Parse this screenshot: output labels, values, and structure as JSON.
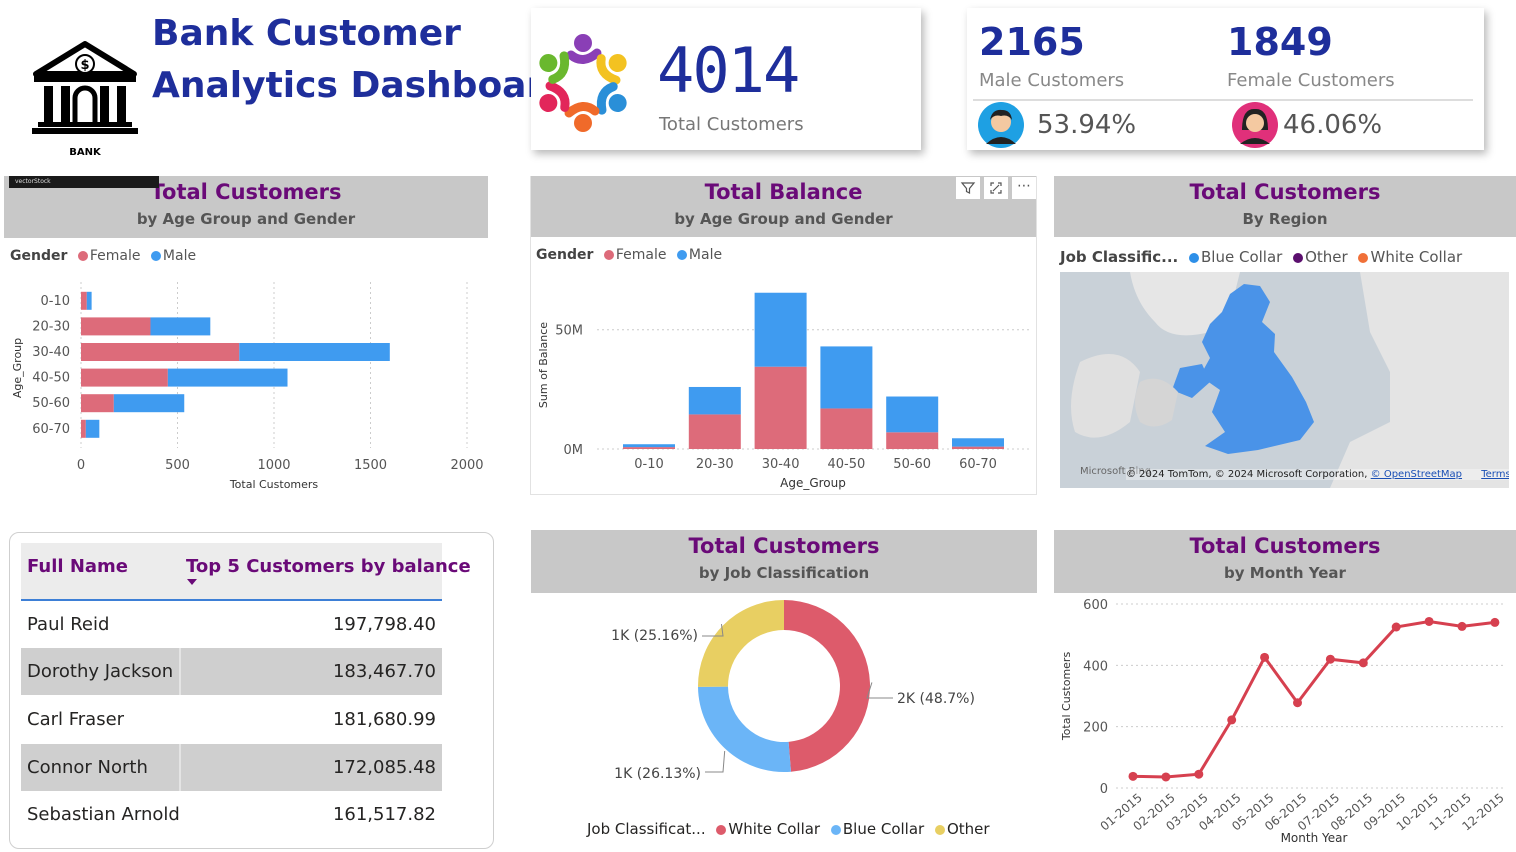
{
  "header": {
    "title_line1": "Bank Customer",
    "title_line2": "Analytics Dashboard",
    "logo_label": "BANK"
  },
  "kpi_total": {
    "value": "4014",
    "label": "Total Customers"
  },
  "kpi_gender": {
    "male_value": "2165",
    "male_label": "Male Customers",
    "male_pct": "53.94%",
    "female_value": "1849",
    "female_label": "Female Customers",
    "female_pct": "46.06%"
  },
  "panels": {
    "age_gender_customers": {
      "title": "Total Customers",
      "subtitle": "by Age Group and Gender",
      "stock_label": "vectorStock"
    },
    "age_gender_balance": {
      "title": "Total Balance",
      "subtitle": "by Age Group and Gender"
    },
    "region": {
      "title": "Total Customers",
      "subtitle": "By Region"
    },
    "job": {
      "title": "Total Customers",
      "subtitle": "by Job Classification"
    },
    "month": {
      "title": "Total Customers",
      "subtitle": "by Month Year"
    }
  },
  "legends": {
    "gender_title": "Gender",
    "female": "Female",
    "male": "Male",
    "job_title_region": "Job Classific...",
    "job_title_donut": "Job Classificat...",
    "blue_collar": "Blue Collar",
    "other": "Other",
    "white_collar": "White Collar"
  },
  "map": {
    "attribution": "© 2024 TomTom, © 2024 Microsoft Corporation,",
    "osm_link": "© OpenStreetMap",
    "terms_link": "Terms",
    "brand": "Microsoft Bing"
  },
  "table": {
    "col_name": "Full Name",
    "col_balance": "Top 5 Customers by balance",
    "rows": [
      {
        "name": "Paul Reid",
        "balance": "197,798.40"
      },
      {
        "name": "Dorothy Jackson",
        "balance": "183,467.70"
      },
      {
        "name": "Carl Fraser",
        "balance": "181,680.99"
      },
      {
        "name": "Connor North",
        "balance": "172,085.48"
      },
      {
        "name": "Sebastian Arnold",
        "balance": "161,517.82"
      }
    ]
  },
  "colors": {
    "female": "#dd6b7a",
    "male": "#3f9bf0",
    "white_collar": "#dd5b6b",
    "blue_collar": "#6bb5f7",
    "other": "#e8cf62",
    "line": "#d6404f",
    "title_blue": "#1e2e9b",
    "purple": "#6a0a78"
  },
  "chart_data": [
    {
      "type": "bar",
      "orientation": "horizontal",
      "stacked": true,
      "categories": [
        "0-10",
        "20-30",
        "30-40",
        "40-50",
        "50-60",
        "60-70"
      ],
      "series": [
        {
          "name": "Female",
          "values": [
            30,
            360,
            820,
            450,
            170,
            25
          ]
        },
        {
          "name": "Male",
          "values": [
            25,
            310,
            780,
            620,
            365,
            70
          ]
        }
      ],
      "xlabel": "Total Customers",
      "ylabel": "Age_Group",
      "xticks": [
        "0",
        "500",
        "1000",
        "1500",
        "2000"
      ],
      "xlim": [
        0,
        2000
      ]
    },
    {
      "type": "bar",
      "stacked": true,
      "categories": [
        "0-10",
        "20-30",
        "30-40",
        "40-50",
        "50-60",
        "60-70"
      ],
      "series": [
        {
          "name": "Female",
          "values": [
            0.8,
            14.5,
            34.5,
            17,
            7,
            1
          ]
        },
        {
          "name": "Male",
          "values": [
            1.2,
            11.5,
            31,
            26,
            15,
            3.5
          ]
        }
      ],
      "xlabel": "Age_Group",
      "ylabel": "Sum of Balance",
      "yticks": [
        "0M",
        "50M"
      ],
      "ylim": [
        0,
        70
      ]
    },
    {
      "type": "pie",
      "donut": true,
      "labels": [
        "White Collar",
        "Blue Collar",
        "Other"
      ],
      "values": [
        48.7,
        26.13,
        25.16
      ],
      "data_labels": [
        "2K (48.7%)",
        "1K (26.13%)",
        "1K (25.16%)"
      ]
    },
    {
      "type": "line",
      "x": [
        "01-2015",
        "02-2015",
        "03-2015",
        "04-2015",
        "05-2015",
        "06-2015",
        "07-2015",
        "08-2015",
        "09-2015",
        "10-2015",
        "11-2015",
        "12-2015"
      ],
      "series": [
        {
          "values": [
            38,
            36,
            45,
            222,
            426,
            278,
            420,
            408,
            525,
            543,
            527,
            540
          ]
        }
      ],
      "xlabel": "Month Year",
      "ylabel": "Total Customers",
      "yticks": [
        "0",
        "200",
        "400",
        "600"
      ],
      "ylim": [
        0,
        600
      ]
    }
  ]
}
